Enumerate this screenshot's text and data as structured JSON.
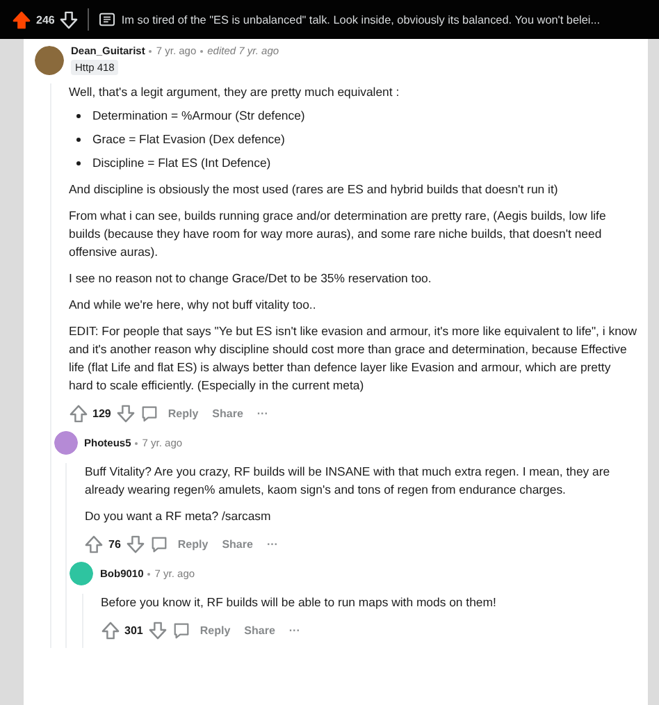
{
  "post_bar": {
    "upvoted": true,
    "score": "246",
    "title": "Im so tired of the \"ES is unbalanced\" talk. Look inside, obviously its balanced. You won't belei..."
  },
  "comments": [
    {
      "author": "Dean_Guitarist",
      "color": "#8a6a3c",
      "time": "7 yr. ago",
      "edited": "edited 7 yr. ago",
      "flair": "Http 418",
      "body": [
        {
          "kind": "p",
          "text": "Well, that's a legit argument, they are pretty much equivalent :"
        },
        {
          "kind": "list",
          "items": [
            "Determination = %Armour (Str defence)",
            "Grace = Flat Evasion (Dex defence)",
            "Discipline = Flat ES (Int Defence)"
          ]
        },
        {
          "kind": "p",
          "text": "And discipline is obsiously the most used (rares are ES and hybrid builds that doesn't run it)"
        },
        {
          "kind": "p",
          "text": "From what i can see, builds running grace and/or determination are pretty rare, (Aegis builds, low life builds (because they have room for way more auras), and some rare niche builds, that doesn't need offensive auras)."
        },
        {
          "kind": "p",
          "text": "I see no reason not to change Grace/Det to be 35% reservation too."
        },
        {
          "kind": "p",
          "text": "And while we're here, why not buff vitality too.."
        },
        {
          "kind": "p",
          "text": "EDIT: For people that says \"Ye but ES isn't like evasion and armour, it's more like equivalent to life\", i know and it's another reason why discipline should cost more than grace and determination, because Effective life (flat Life and flat ES) is always better than defence layer like Evasion and armour, which are pretty hard to scale efficiently. (Especially in the current meta)"
        }
      ],
      "score": "129",
      "reply": "Reply",
      "share": "Share",
      "more": "···",
      "children": [
        {
          "author": "Photeus5",
          "color": "#b58ad6",
          "time": "7 yr. ago",
          "body": [
            {
              "kind": "p",
              "text": "Buff Vitality? Are you crazy, RF builds will be INSANE with that much extra regen. I mean, they are already wearing regen% amulets, kaom sign's and tons of regen from endurance charges."
            },
            {
              "kind": "p",
              "text": "Do you want a RF meta? /sarcasm"
            }
          ],
          "score": "76",
          "reply": "Reply",
          "share": "Share",
          "more": "···",
          "children": [
            {
              "author": "Bob9010",
              "color": "#2ec4a0",
              "time": "7 yr. ago",
              "body": [
                {
                  "kind": "p",
                  "text": "Before you know it, RF builds will be able to run maps with mods on them!"
                }
              ],
              "score": "301",
              "reply": "Reply",
              "share": "Share",
              "more": "···"
            }
          ]
        }
      ]
    }
  ]
}
